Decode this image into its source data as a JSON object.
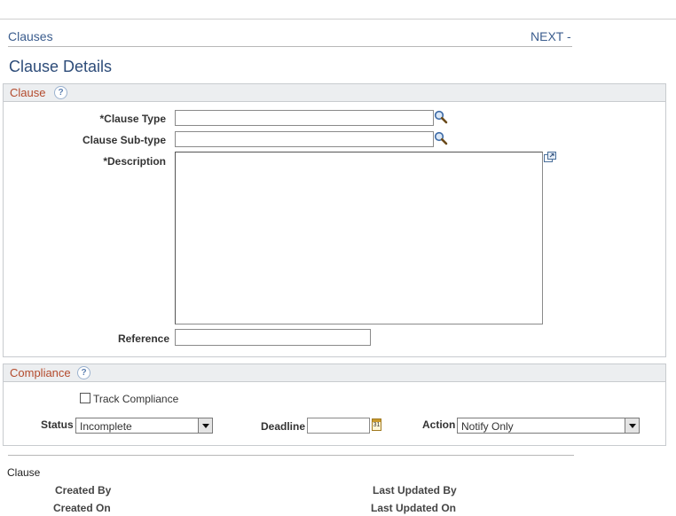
{
  "nav": {
    "back_label": "Clauses",
    "next_label": "NEXT -"
  },
  "page_title": "Clause Details",
  "clause_section": {
    "title": "Clause",
    "help_icon": "?",
    "clause_type_label": "*Clause Type",
    "clause_type_value": "",
    "clause_subtype_label": "Clause Sub-type",
    "clause_subtype_value": "",
    "description_label": "*Description",
    "description_value": "",
    "reference_label": "Reference",
    "reference_value": ""
  },
  "compliance_section": {
    "title": "Compliance",
    "help_icon": "?",
    "track_compliance_label": "Track Compliance",
    "track_compliance_checked": false,
    "status_label": "Status",
    "status_value": "Incomplete",
    "deadline_label": "Deadline",
    "deadline_value": "",
    "calendar_glyph": "31",
    "action_label": "Action",
    "action_value": "Notify Only"
  },
  "audit": {
    "heading": "Clause",
    "created_by_label": "Created By",
    "created_on_label": "Created On",
    "last_updated_by_label": "Last Updated By",
    "last_updated_on_label": "Last Updated On"
  },
  "colors": {
    "link": "#3b5d8e",
    "section_title": "#b34a2c",
    "page_title": "#2d4c79"
  }
}
